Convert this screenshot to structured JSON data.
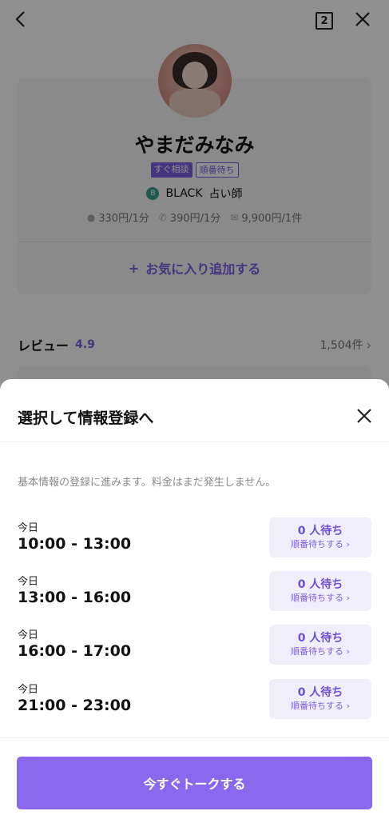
{
  "header": {
    "page_count": "2"
  },
  "profile": {
    "name": "やまだみなみ",
    "badges": [
      "すぐ相談",
      "順番待ち"
    ],
    "rank_icon": "B",
    "rank": "BLACK",
    "role": "占い師",
    "prices": [
      {
        "icon": "chat-icon",
        "label": "330円/1分"
      },
      {
        "icon": "phone-icon",
        "label": "390円/1分"
      },
      {
        "icon": "mail-icon",
        "label": "9,900円/1件"
      }
    ],
    "favorite_label": "お気に入り追加する",
    "favorite_icon": "plus-icon"
  },
  "review": {
    "label": "レビュー",
    "score": "4.9",
    "count": "1,504件"
  },
  "sheet": {
    "title": "選択して情報登録へ",
    "notice": "基本情報の登録に進みます。料金はまだ発生しません。",
    "slots": [
      {
        "day": "今日",
        "time": "10:00 - 13:00",
        "wait": "0 人待ち",
        "action": "順番待ちする"
      },
      {
        "day": "今日",
        "time": "13:00 - 16:00",
        "wait": "0 人待ち",
        "action": "順番待ちする"
      },
      {
        "day": "今日",
        "time": "16:00 - 17:00",
        "wait": "0 人待ち",
        "action": "順番待ちする"
      },
      {
        "day": "今日",
        "time": "21:00 - 23:00",
        "wait": "0 人待ち",
        "action": "順番待ちする"
      }
    ],
    "talk_button": "今すぐトークする"
  },
  "colors": {
    "accent": "#7b5fe0",
    "button": "#8a68ee",
    "wait_bg": "#f1eefc"
  }
}
